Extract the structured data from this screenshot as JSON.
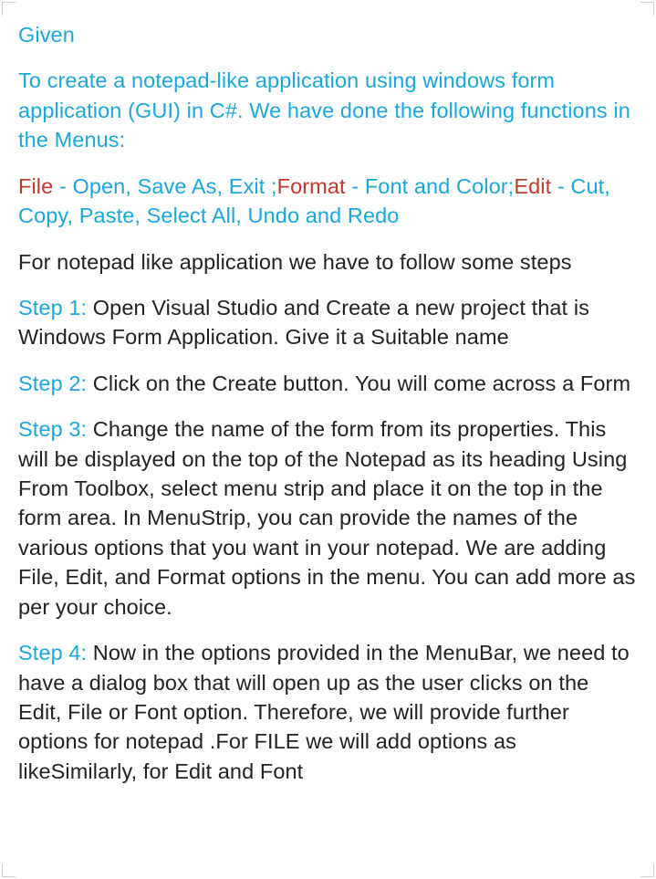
{
  "heading": "Given",
  "intro": "To create a notepad-like application using windows form application (GUI) in C#. We have done the following functions in the Menus:",
  "menus": {
    "file_label": "File",
    "file_items": " - Open, Save As, Exit ;",
    "format_label": "Format",
    "format_items": " - Font and Color;",
    "edit_label": "Edit",
    "edit_items": " - Cut, Copy, Paste, Select All, Undo and Redo"
  },
  "note": "For notepad like application we have to follow some steps",
  "steps": [
    {
      "label": "Step 1:",
      "text": " Open Visual Studio and Create a new project that is Windows Form Application. Give it a Suitable name"
    },
    {
      "label": "Step 2:",
      "text": " Click on the Create button. You will come across a Form"
    },
    {
      "label": "Step 3:",
      "text": " Change the name of the form from its properties. This will be displayed on the top of the Notepad as its heading Using From Toolbox, select menu strip and place it on the top in the form area. In MenuStrip, you can provide the names of the various options that you want in your notepad. We are adding File, Edit, and Format options in the menu. You can add more as per your choice."
    },
    {
      "label": "Step 4:",
      "text": "  Now in the options provided in the MenuBar, we need to have a dialog box that will open up as the user clicks on the  Edit, File or Font option. Therefore, we will provide further options for notepad .For FILE we will add options as likeSimilarly, for Edit and Font"
    }
  ]
}
